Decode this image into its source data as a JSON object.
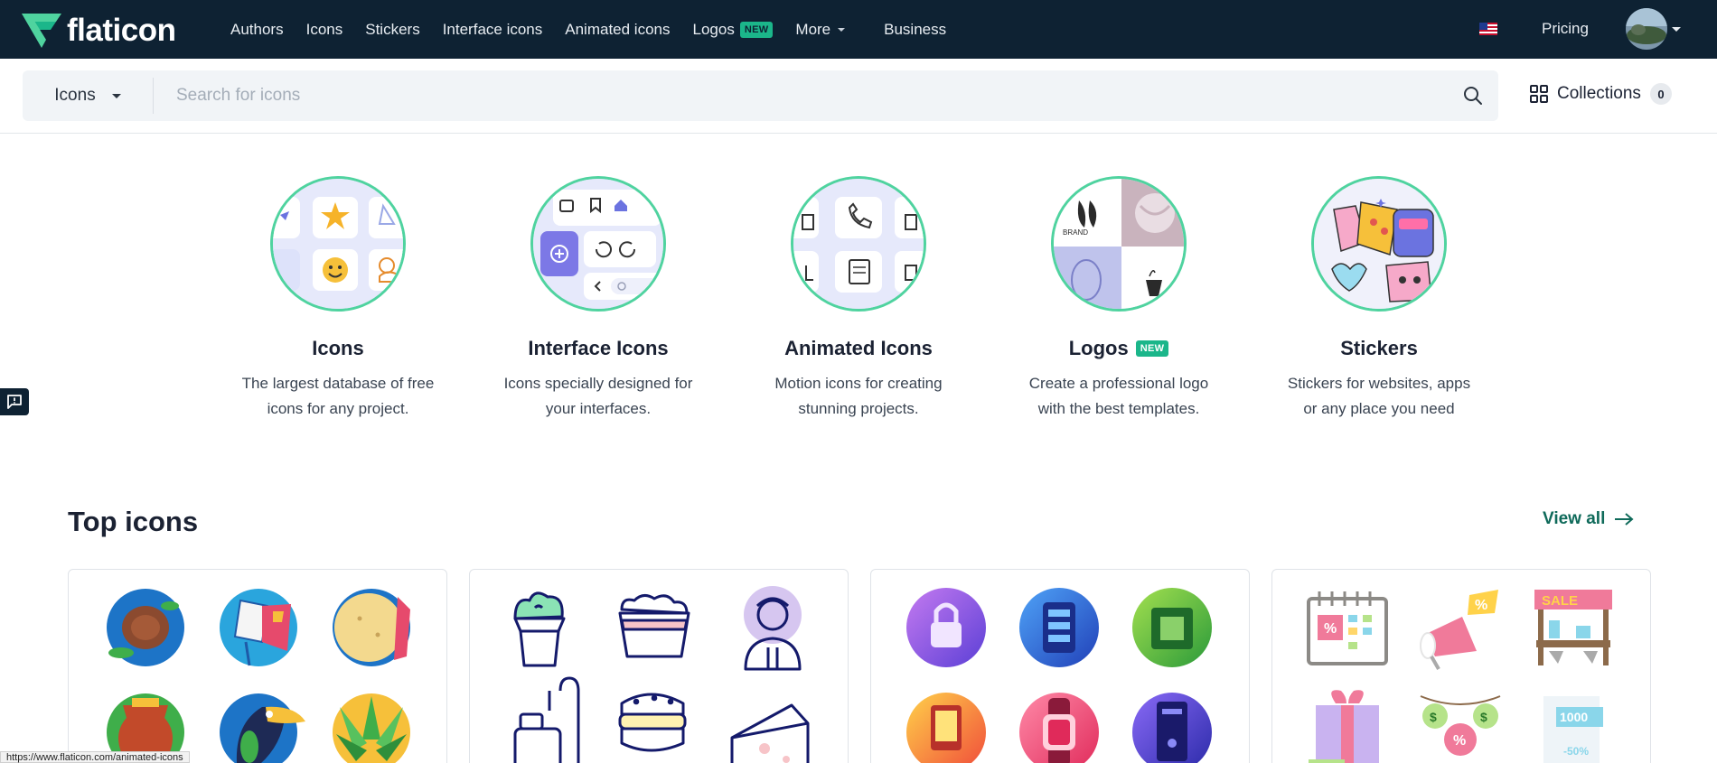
{
  "brand": {
    "name": "flaticon"
  },
  "nav": {
    "links": [
      {
        "label": "Authors"
      },
      {
        "label": "Icons"
      },
      {
        "label": "Stickers"
      },
      {
        "label": "Interface icons"
      },
      {
        "label": "Animated icons"
      },
      {
        "label": "Logos",
        "badge": "NEW"
      },
      {
        "label": "More"
      },
      {
        "label": "Business"
      }
    ],
    "pricing": "Pricing",
    "flag_icon": "us-flag-icon"
  },
  "search": {
    "type": "Icons",
    "placeholder": "Search for icons"
  },
  "collections": {
    "label": "Collections",
    "count": "0"
  },
  "categories": [
    {
      "title": "Icons",
      "desc": "The largest database of free icons for any project."
    },
    {
      "title": "Interface Icons",
      "desc": "Icons specially designed for your interfaces."
    },
    {
      "title": "Animated Icons",
      "desc": "Motion icons for creating stunning projects."
    },
    {
      "title": "Logos",
      "badge": "NEW",
      "desc": "Create a professional logo with the best templates."
    },
    {
      "title": "Stickers",
      "desc": "Stickers for websites, apps or any place you need"
    }
  ],
  "top_icons": {
    "title": "Top icons",
    "view_all": "View all"
  },
  "status_url": "https://www.flaticon.com/animated-icons",
  "colors": {
    "nav_bg": "#0e2233",
    "accent_green": "#1bb68a",
    "circle_border": "#4fd39f"
  }
}
